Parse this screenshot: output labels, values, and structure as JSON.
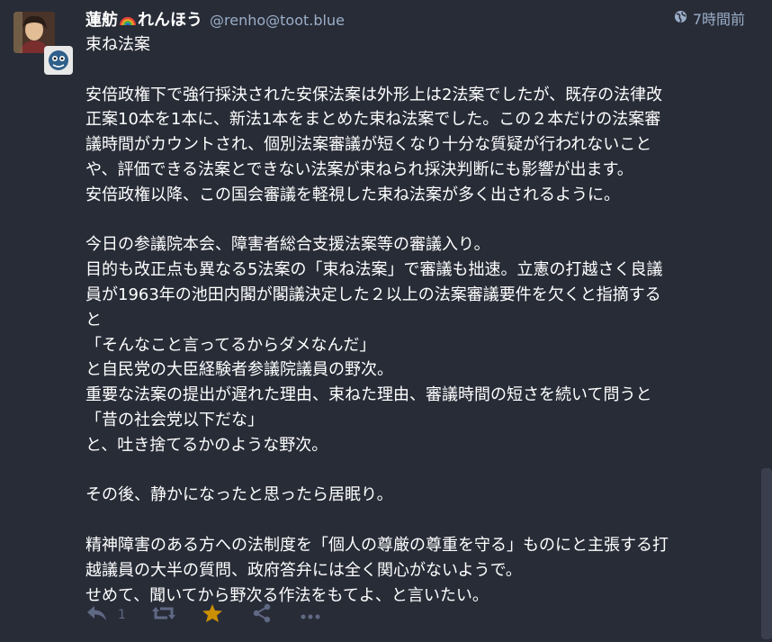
{
  "status": {
    "display_name": "蓮舫",
    "display_name_suffix": "れんほう",
    "rainbow_icon": "rainbow-emoji",
    "acct": "@renho@toot.blue",
    "visibility_icon": "globe-icon",
    "timestamp": "7時間前",
    "paragraphs": [
      [
        "束ね法案"
      ],
      [
        "安倍政権下で強行採決された安保法案は外形上は2法案でしたが、既存の法律改",
        "正案10本を1本に、新法1本をまとめた束ね法案でした。この２本だけの法案審",
        "議時間がカウントされ、個別法案審議が短くなり十分な質疑が行われないこと",
        "や、評価できる法案とできない法案が束ねられ採決判断にも影響が出ます。",
        "安倍政権以降、この国会審議を軽視した束ね法案が多く出されるように。"
      ],
      [
        "今日の参議院本会、障害者総合支援法案等の審議入り。",
        "目的も改正点も異なる5法案の「束ね法案」で審議も拙速。立憲の打越さく良議",
        "員が1963年の池田内閣が閣議決定した２以上の法案審議要件を欠くと指摘する",
        "と",
        "「そんなこと言ってるからダメなんだ」",
        "と自民党の大臣経験者参議院議員の野次。",
        "重要な法案の提出が遅れた理由、束ねた理由、審議時間の短さを続いて問うと",
        "「昔の社会党以下だな」",
        "と、吐き捨てるかのような野次。"
      ],
      [
        "その後、静かになったと思ったら居眠り。"
      ],
      [
        "精神障害のある方への法制度を「個人の尊厳の尊重を守る」ものにと主張する打",
        "越議員の大半の質問、政府答弁には全く関心がないようで。",
        "せめて、聞いてから野次る作法をもてよ、と言いたい。"
      ]
    ],
    "actions": {
      "reply_icon": "reply-icon",
      "reply_count": "1",
      "boost_icon": "boost-icon",
      "favourite_icon": "star-icon",
      "share_icon": "share-icon",
      "more_icon": "more-icon"
    },
    "colors": {
      "background": "#282c37",
      "secondary_text": "#9baec8",
      "action_icon": "#606984",
      "favourite": "#ca8f04"
    }
  }
}
